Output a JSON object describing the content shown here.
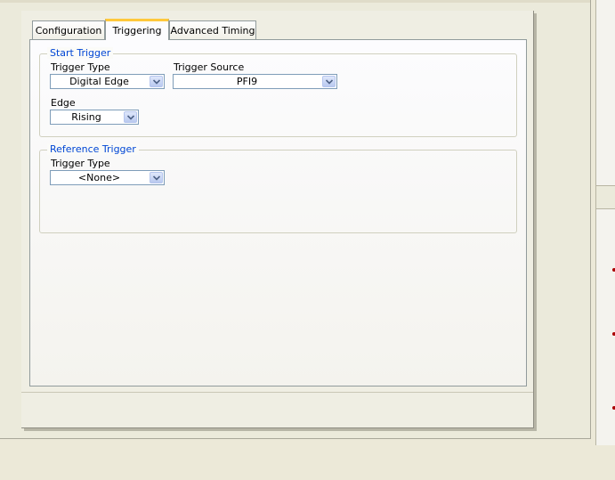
{
  "tabs": [
    {
      "label": "Configuration",
      "active": false
    },
    {
      "label": "Triggering",
      "active": true
    },
    {
      "label": "Advanced Timing",
      "active": false
    }
  ],
  "start_trigger": {
    "legend": "Start Trigger",
    "trigger_type_label": "Trigger Type",
    "trigger_type_value": "Digital Edge",
    "trigger_source_label": "Trigger Source",
    "trigger_source_value": "PFI9",
    "edge_label": "Edge",
    "edge_value": "Rising"
  },
  "reference_trigger": {
    "legend": "Reference Trigger",
    "trigger_type_label": "Trigger Type",
    "trigger_type_value": "<None>"
  },
  "colors": {
    "accent_tab": "#ffc83c",
    "legend_text": "#0046d5",
    "combo_border": "#7f9db9"
  },
  "icons": {
    "dropdown": "chevron-down-icon"
  }
}
